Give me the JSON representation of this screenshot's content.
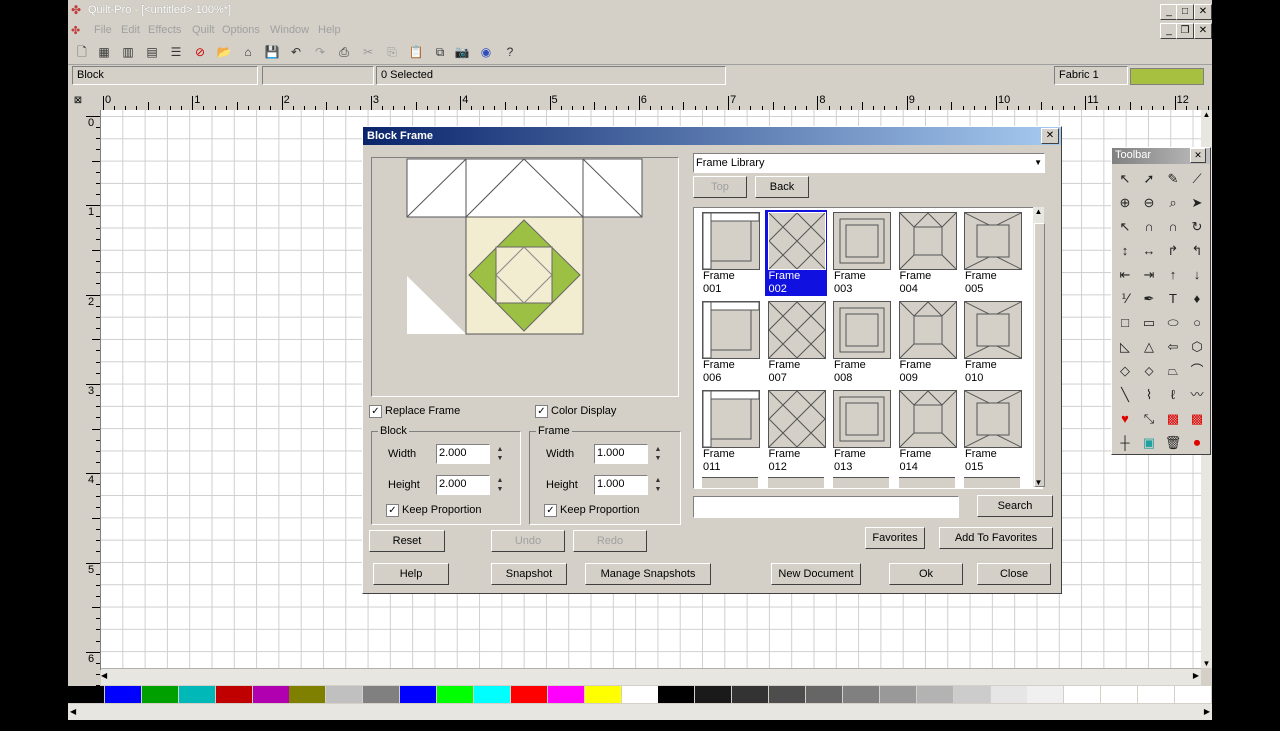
{
  "app": {
    "title": "Quilt-Pro - [<untitled> 100%*]",
    "window_controls": [
      "_",
      "□",
      "✕"
    ],
    "doc_controls": [
      "_",
      "❐",
      "✕"
    ]
  },
  "menu": [
    "File",
    "Edit",
    "Effects",
    "Quilt",
    "Options",
    "Window",
    "Help"
  ],
  "status": {
    "mode": "Block",
    "blank": "",
    "selected": "0 Selected",
    "fabric_label": "Fabric 1",
    "fabric_color": "#a8c040"
  },
  "ruler": {
    "h_labels": [
      "0",
      "1",
      "2",
      "3",
      "4",
      "5",
      "6",
      "7",
      "8",
      "9",
      "10",
      "11",
      "12"
    ],
    "v_labels": [
      "0",
      "1",
      "2",
      "3",
      "4",
      "5",
      "6"
    ]
  },
  "palette": [
    "#000000",
    "#0000ff",
    "#00a000",
    "#00b8b8",
    "#c00000",
    "#b000b0",
    "#808000",
    "#c0c0c0",
    "#808080",
    "#0000ff",
    "#00ff00",
    "#00ffff",
    "#ff0000",
    "#ff00ff",
    "#ffff00",
    "#ffffff",
    "#000000",
    "#1a1a1a",
    "#333333",
    "#4d4d4d",
    "#666666",
    "#808080",
    "#999999",
    "#b3b3b3",
    "#cccccc",
    "#e6e6e6",
    "#f0f0f0",
    "#ffffff",
    "#ffffff",
    "#ffffff",
    "#ffffff"
  ],
  "dialog": {
    "title": "Block Frame",
    "library_select": "Frame Library",
    "top_label": "Top",
    "back_label": "Back",
    "replace_frame_label": "Replace Frame",
    "color_display_label": "Color Display",
    "replace_frame_checked": true,
    "color_display_checked": true,
    "block_group": "Block",
    "frame_group": "Frame",
    "width_label": "Width",
    "height_label": "Height",
    "block_width": "2.000",
    "block_height": "2.000",
    "frame_width": "1.000",
    "frame_height": "1.000",
    "keep_proportion_label": "Keep Proportion",
    "search_value": "",
    "buttons": {
      "search": "Search",
      "favorites": "Favorites",
      "add_to_favorites": "Add To Favorites",
      "reset": "Reset",
      "undo": "Undo",
      "redo": "Redo",
      "help": "Help",
      "snapshot": "Snapshot",
      "manage_snapshots": "Manage Snapshots",
      "new_document": "New Document",
      "ok": "Ok",
      "close": "Close"
    },
    "frames": [
      {
        "line1": "Frame",
        "line2": "001"
      },
      {
        "line1": "Frame",
        "line2": "002"
      },
      {
        "line1": "Frame",
        "line2": "003"
      },
      {
        "line1": "Frame",
        "line2": "004"
      },
      {
        "line1": "Frame",
        "line2": "005"
      },
      {
        "line1": "Frame",
        "line2": "006"
      },
      {
        "line1": "Frame",
        "line2": "007"
      },
      {
        "line1": "Frame",
        "line2": "008"
      },
      {
        "line1": "Frame",
        "line2": "009"
      },
      {
        "line1": "Frame",
        "line2": "010"
      },
      {
        "line1": "Frame",
        "line2": "011"
      },
      {
        "line1": "Frame",
        "line2": "012"
      },
      {
        "line1": "Frame",
        "line2": "013"
      },
      {
        "line1": "Frame",
        "line2": "014"
      },
      {
        "line1": "Frame",
        "line2": "015"
      }
    ],
    "selected_frame": "002",
    "block_colors": {
      "cream": "#f2ecd0",
      "green": "#9cc044"
    }
  },
  "toolbox": {
    "title": "Toolbar"
  }
}
